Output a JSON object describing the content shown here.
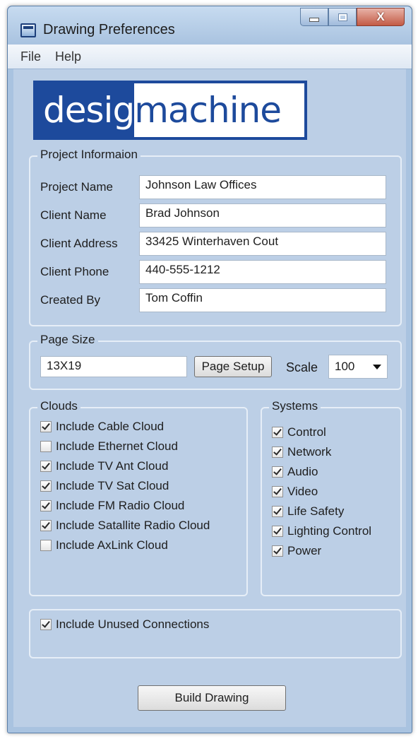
{
  "window": {
    "title": "Drawing Preferences",
    "minimize_glyph": "minimize-icon",
    "maximize_glyph": "maximize-icon",
    "close_glyph": "X"
  },
  "menu": {
    "items": [
      "File",
      "Help"
    ]
  },
  "logo": {
    "text_left": "desig",
    "text_right": "machine"
  },
  "project_info": {
    "legend": "Project Informaion",
    "fields": [
      {
        "label": "Project Name",
        "value": "Johnson Law Offices"
      },
      {
        "label": "Client Name",
        "value": "Brad Johnson"
      },
      {
        "label": "Client Address",
        "value": "33425 Winterhaven Cout"
      },
      {
        "label": "Client Phone",
        "value": "440-555-1212"
      },
      {
        "label": "Created By",
        "value": "Tom Coffin"
      }
    ]
  },
  "page_size": {
    "legend": "Page Size",
    "value": "13X19",
    "setup_button": "Page Setup",
    "scale_label": "Scale",
    "scale_value": "100"
  },
  "clouds": {
    "legend": "Clouds",
    "items": [
      {
        "label": "Include Cable Cloud",
        "checked": true
      },
      {
        "label": "Include Ethernet Cloud",
        "checked": false
      },
      {
        "label": "Include TV Ant Cloud",
        "checked": true
      },
      {
        "label": "Include TV Sat Cloud",
        "checked": true
      },
      {
        "label": "Include FM Radio Cloud",
        "checked": true
      },
      {
        "label": "Include Satallite Radio Cloud",
        "checked": true
      },
      {
        "label": "Include AxLink Cloud",
        "checked": false
      }
    ]
  },
  "systems": {
    "legend": "Systems",
    "items": [
      {
        "label": "Control",
        "checked": true
      },
      {
        "label": "Network",
        "checked": true
      },
      {
        "label": "Audio",
        "checked": true
      },
      {
        "label": "Video",
        "checked": true
      },
      {
        "label": "Life Safety",
        "checked": true
      },
      {
        "label": "Lighting Control",
        "checked": true
      },
      {
        "label": "Power",
        "checked": true
      }
    ]
  },
  "unused": {
    "label": "Include Unused Connections",
    "checked": true
  },
  "build_button": "Build Drawing"
}
